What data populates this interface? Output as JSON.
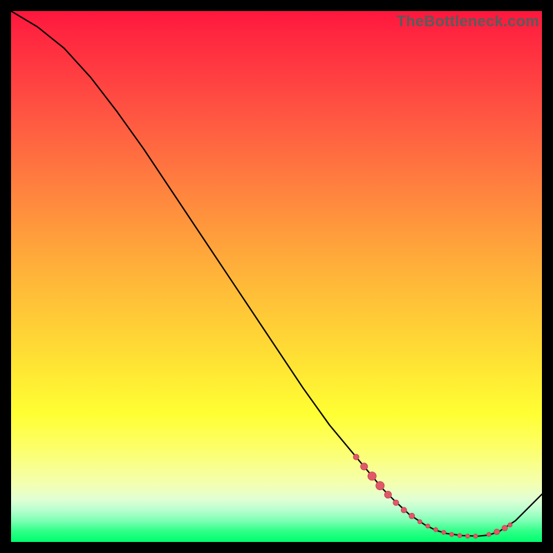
{
  "watermark": "TheBottleneck.com",
  "colors": {
    "dot_fill": "#e15968",
    "dot_stroke": "#c24856",
    "curve": "#000000"
  },
  "chart_data": {
    "type": "line",
    "title": "",
    "xlabel": "",
    "ylabel": "",
    "xlim": [
      0,
      100
    ],
    "ylim": [
      0,
      100
    ],
    "grid": false,
    "legend": false,
    "series": [
      {
        "name": "curve",
        "x": [
          0,
          5,
          10,
          15,
          20,
          25,
          30,
          35,
          40,
          45,
          50,
          55,
          60,
          65,
          70,
          72,
          75,
          78,
          80,
          82,
          85,
          88,
          90,
          92,
          95,
          100
        ],
        "y": [
          100,
          97,
          93,
          87.5,
          81,
          74,
          66.5,
          59,
          51.5,
          44,
          36.5,
          29,
          22,
          16,
          10,
          8,
          5.2,
          3.2,
          2.2,
          1.6,
          1.2,
          1.1,
          1.3,
          2.0,
          4.0,
          9.0
        ]
      }
    ],
    "markers": [
      {
        "x": 65,
        "y": 16,
        "r": 4
      },
      {
        "x": 66.5,
        "y": 14.2,
        "r": 5
      },
      {
        "x": 68,
        "y": 12.4,
        "r": 6
      },
      {
        "x": 69.5,
        "y": 10.6,
        "r": 6
      },
      {
        "x": 71,
        "y": 8.9,
        "r": 5
      },
      {
        "x": 72.5,
        "y": 7.4,
        "r": 4
      },
      {
        "x": 74,
        "y": 6.0,
        "r": 4
      },
      {
        "x": 75.5,
        "y": 4.9,
        "r": 4
      },
      {
        "x": 77,
        "y": 3.8,
        "r": 3
      },
      {
        "x": 78.5,
        "y": 3.0,
        "r": 3
      },
      {
        "x": 80,
        "y": 2.3,
        "r": 3
      },
      {
        "x": 81.5,
        "y": 1.8,
        "r": 3
      },
      {
        "x": 83,
        "y": 1.4,
        "r": 3
      },
      {
        "x": 84.5,
        "y": 1.2,
        "r": 3
      },
      {
        "x": 86,
        "y": 1.1,
        "r": 3
      },
      {
        "x": 87.5,
        "y": 1.1,
        "r": 3
      },
      {
        "x": 90,
        "y": 1.4,
        "r": 3
      },
      {
        "x": 91.5,
        "y": 1.9,
        "r": 4
      },
      {
        "x": 93,
        "y": 2.6,
        "r": 4
      },
      {
        "x": 94,
        "y": 3.2,
        "r": 3
      }
    ]
  }
}
